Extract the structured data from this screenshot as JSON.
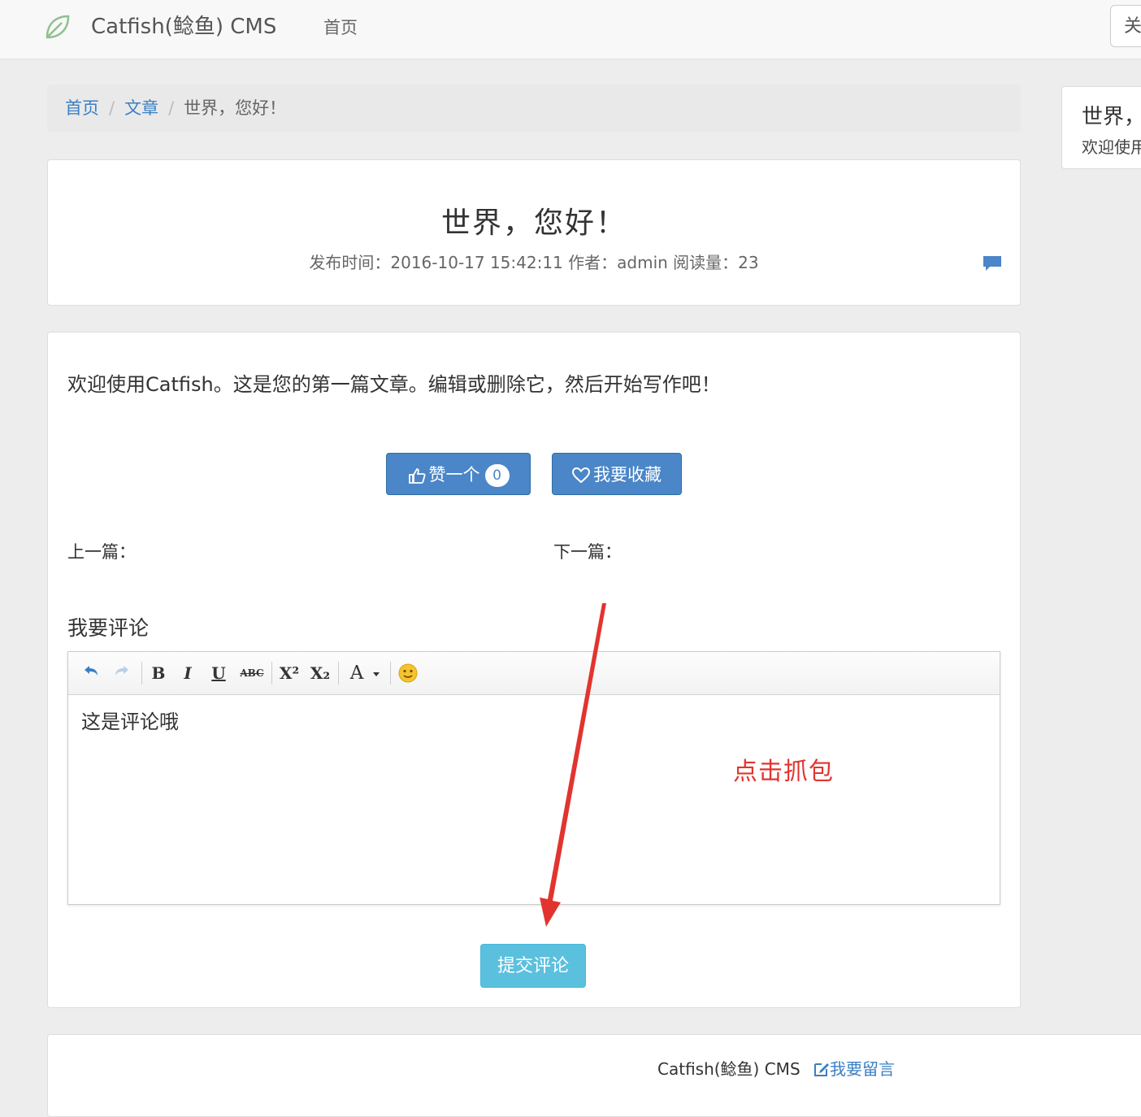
{
  "navbar": {
    "brand": "Catfish(鲶鱼) CMS",
    "home": "首页",
    "right_button": "关"
  },
  "breadcrumb": {
    "home": "首页",
    "section": "文章",
    "current": "世界，您好！",
    "separator": "/"
  },
  "sidebar": {
    "title": "世界，",
    "text": "欢迎使用"
  },
  "article": {
    "title": "世界，您好！",
    "meta": "发布时间：2016-10-17 15:42:11 作者：admin 阅读量：23",
    "content": "欢迎使用Catfish。这是您的第一篇文章。编辑或删除它，然后开始写作吧！",
    "like_label": "赞一个",
    "like_count": "0",
    "favorite_label": "我要收藏",
    "prev_label": "上一篇：",
    "next_label": "下一篇："
  },
  "comment": {
    "heading": "我要评论",
    "editor_text": "这是评论哦",
    "submit_label": "提交评论",
    "toolbar": {
      "bold": "B",
      "italic": "I",
      "underline": "U",
      "strike": "ABC",
      "superscript": "X²",
      "subscript": "X₂",
      "font_color": "A"
    }
  },
  "annotation": {
    "text": "点击抓包",
    "color": "#e2342f"
  },
  "footer": {
    "brand": "Catfish(鲶鱼) CMS",
    "message_link": "我要留言"
  },
  "colors": {
    "primary": "#4a86c8",
    "info": "#5bc0de",
    "link": "#3a7fc4"
  }
}
